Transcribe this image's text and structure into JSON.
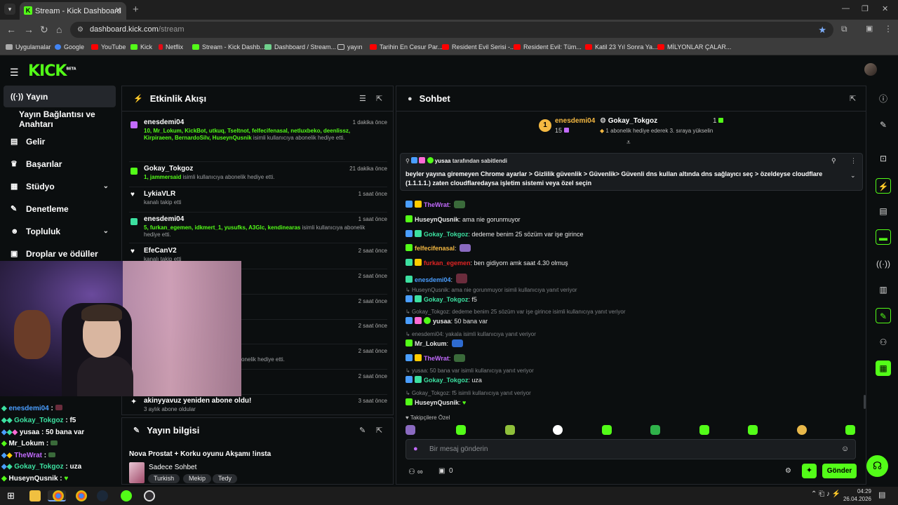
{
  "browser": {
    "tab_title": "Stream - Kick Dashboard",
    "tab_favicon": "K",
    "url_host": "dashboard.kick.com",
    "url_path": "/stream",
    "bookmarks": [
      "Uygulamalar",
      "Google",
      "YouTube",
      "Kick",
      "Netflix",
      "Stream - Kick Dashb...",
      "Dashboard / Stream...",
      "yayın",
      "Tarihin En Cesur Par...",
      "Resident Evil Serisi -...",
      "Resident Evil: Tüm...",
      "Katil 23 Yıl Sonra Ya...",
      "MİLYONLAR ÇALAR..."
    ]
  },
  "kick": {
    "logo": "KICK",
    "logo_beta": "BETA",
    "accent": "#53fc18"
  },
  "sidebar": {
    "items": [
      {
        "label": "Yayın",
        "icon": "broadcast-icon"
      },
      {
        "label": "Yayın Bağlantısı ve Anahtarı",
        "icon": ""
      },
      {
        "label": "Gelir",
        "icon": "chart-icon"
      },
      {
        "label": "Başarılar",
        "icon": "trophy-icon"
      },
      {
        "label": "Stüdyo",
        "icon": "studio-icon"
      },
      {
        "label": "Denetleme",
        "icon": "wrench-icon"
      },
      {
        "label": "Topluluk",
        "icon": "community-icon"
      },
      {
        "label": "Droplar ve ödüller",
        "icon": "gift-icon"
      }
    ]
  },
  "activity": {
    "title": "Etkinlik Akışı",
    "items": [
      {
        "name": "enesdemi04",
        "time": "1 dakika önce",
        "highlight": "10, Mr_Lokum, KickBot, utkuq, Tseltnot, felfecifenasal, netluxbeko, deenlissz, Kirpiraeen, BernardoSilv, HuseynQusnik",
        "desc": "isimli kullanıcıya abonelik hediye etti.",
        "color": "#c36bff"
      },
      {
        "name": "Gokay_Tokgoz",
        "time": "21 dakika önce",
        "highlight": "1, jammersaid",
        "desc": "isimli kullanıcıya abonelik hediye etti.",
        "color": "#53fc18"
      },
      {
        "name": "LykiaVLR",
        "time": "1 saat önce",
        "highlight": "",
        "desc": "kanalı takip etti",
        "color": "#ffffff"
      },
      {
        "name": "enesdemi04",
        "time": "1 saat önce",
        "highlight": "5, furkan_egemen, idkmert_1, yusufks, A3Glc, kendinearas",
        "desc": "isimli kullanıcıya abonelik hediye etti.",
        "color": "#3ce0a0"
      },
      {
        "name": "EfeCanV2",
        "time": "2 saat önce",
        "highlight": "",
        "desc": "kanalı takip etti",
        "color": "#ffffff"
      },
      {
        "name": "",
        "time": "2 saat önce",
        "highlight": "",
        "desc": "",
        "color": "#ffffff"
      },
      {
        "name": "",
        "time": "2 saat önce",
        "highlight": "",
        "desc": "",
        "color": "#ffffff"
      },
      {
        "name": "",
        "time": "2 saat önce",
        "highlight": "",
        "desc": "",
        "color": "#ffffff"
      },
      {
        "name": "",
        "time": "2 saat önce",
        "highlight": "",
        "desc": "onelik hediye etti.",
        "color": "#ffffff"
      },
      {
        "name": "",
        "time": "2 saat önce",
        "highlight": "",
        "desc": "",
        "color": "#ffffff"
      },
      {
        "name": "akinyyavuz yeniden abone oldu!",
        "time": "3 saat önce",
        "highlight": "3 aylık abone oldular",
        "desc": "",
        "color": "#ffffff"
      }
    ]
  },
  "overlay_chat": [
    {
      "user": "enesdemi04",
      "text": "",
      "color": "#4a9eff"
    },
    {
      "user": "Gokay_Tokgoz",
      "text": "f5",
      "color": "#3ce0a0"
    },
    {
      "user": "yusaa",
      "text": "50 bana var",
      "color": "#ffffff"
    },
    {
      "user": "Mr_Lokum",
      "text": "",
      "color": "#ffffff"
    },
    {
      "user": "TheWrat",
      "text": "",
      "color": "#c36bff"
    },
    {
      "user": "Gokay_Tokgoz",
      "text": "uza",
      "color": "#3ce0a0"
    },
    {
      "user": "HuseynQusnik",
      "text": "",
      "color": "#ffffff"
    }
  ],
  "stream_info": {
    "title": "Yayın bilgisi",
    "stream_title": "Nova Prostat + Korku oyunu Akşamı !insta",
    "category": "Sadece Sohbet",
    "tags": [
      "Turkish",
      "Mekip",
      "Tedy"
    ]
  },
  "chat": {
    "title": "Sohbet",
    "leader_rank": "1",
    "leader_name": "enesdemi04",
    "leader_count": "15",
    "gifter_name": "Gokay_Tokgoz",
    "gifter_count": "1",
    "gifter_desc": "1 abonelik hediye ederek 3. sıraya yükselin",
    "pinned_by": "yusaa",
    "pinned_suffix": "tarafından sabitlendi",
    "pinned_text": "beyler yayına giremeyen Chrome ayarlar > Gizlilik güvenlik > Güvenlik> Güvenli dns kullan altında dns sağlayıcı seç > özeldeyse cloudflare (1.1.1.1.) zaten cloudflaredaysa işletim sistemi veya özel seçin",
    "messages": [
      {
        "user": "TheWrat",
        "text": "",
        "color": "#c36bff",
        "reply": ""
      },
      {
        "user": "HuseynQusnik",
        "text": "ama nie gorunmuyor",
        "color": "#ffffff",
        "reply": ""
      },
      {
        "user": "Gokay_Tokgoz",
        "text": "dedeme benim 25 sözüm var işe girince",
        "color": "#3ce0a0",
        "reply": ""
      },
      {
        "user": "felfecifenasal",
        "text": "",
        "color": "#f5b942",
        "reply": ""
      },
      {
        "user": "furkan_egemen",
        "text": "ben gidiyom amk saat 4.30 olmuş",
        "color": "#e02424",
        "reply": ""
      },
      {
        "user": "enesdemi04",
        "text": "",
        "color": "#4a9eff",
        "reply": ""
      },
      {
        "user": "Gokay_Tokgoz",
        "text": "f5",
        "color": "#3ce0a0",
        "reply": "HuseynQusnik: ama nie gorunmuyor isimli kullanıcıya yanıt veriyor"
      },
      {
        "user": "yusaa",
        "text": "50 bana var",
        "color": "#ffffff",
        "reply": "Gokay_Tokgoz: dedeme benim 25 sözüm var işe girince isimli kullanıcıya yanıt veriyor"
      },
      {
        "user": "Mr_Lokum",
        "text": "",
        "color": "#ffffff",
        "reply": "enesdemi04: yakala isimli kullanıcıya yanıt veriyor"
      },
      {
        "user": "TheWrat",
        "text": "",
        "color": "#c36bff",
        "reply": ""
      },
      {
        "user": "Gokay_Tokgoz",
        "text": "uza",
        "color": "#3ce0a0",
        "reply": "yusaa: 50 bana var isimli kullanıcıya yanıt veriyor"
      },
      {
        "user": "HuseynQusnik",
        "text": "",
        "color": "#ffffff",
        "reply": "Gokay_Tokgoz: f5 isimli kullanıcıya yanıt veriyor"
      }
    ],
    "emote_section": "Takipçilere Özel",
    "input_placeholder": "Bir mesaj gönderin",
    "points": "0",
    "send_label": "Gönder"
  },
  "taskbar": {
    "time": "04:29",
    "date": "26.04.2026"
  }
}
